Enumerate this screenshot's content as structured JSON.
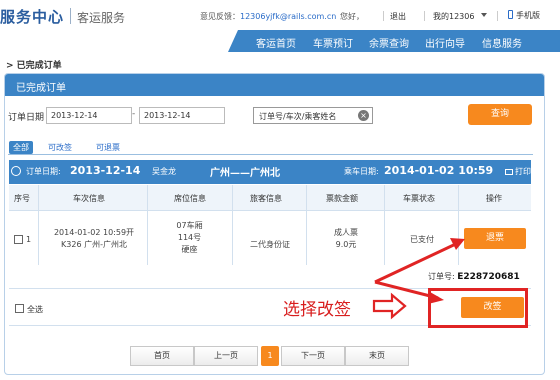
{
  "header": {
    "logo": "服务中心",
    "subtitle": "客运服务",
    "feedback_label": "意见反馈：",
    "feedback_email": "12306yjfk@rails.com.cn",
    "greeting": "您好，",
    "logout": "退出",
    "my_account": "我的12306",
    "mobile": "手机版"
  },
  "nav": {
    "items": [
      "客运首页",
      "车票预订",
      "余票查询",
      "出行向导",
      "信息服务"
    ]
  },
  "breadcrumb": "> 已完成订单",
  "panel": {
    "title": "已完成订单"
  },
  "search": {
    "date_label": "订单日期",
    "date_from": "2013-12-14",
    "date_to": "2013-12-14",
    "dash": "-",
    "keyword_placeholder": "订单号/车次/乘客姓名",
    "query_button": "查询"
  },
  "filters": {
    "all": "全部",
    "changeable": "可改签",
    "refundable": "可退票"
  },
  "order": {
    "order_date_label": "订单日期:",
    "order_date": "2013-12-14",
    "passenger": "吴金龙",
    "route": "广州——广州北",
    "ride_date_label": "乘车日期:",
    "ride_date": "2014-01-02 10:59",
    "print": "打印",
    "columns": [
      "序号",
      "车次信息",
      "席位信息",
      "旅客信息",
      "票款金额",
      "车票状态",
      "操作"
    ],
    "row": {
      "index": "1",
      "train_time": "2014-01-02 10:59开",
      "train_route": "K326 广州-广州北",
      "car": "07车厢",
      "seat_no": "114号",
      "seat_type": "硬座",
      "id_type": "二代身份证",
      "ticket_type": "成人票",
      "amount": "9.0元",
      "status": "已支付",
      "refund_button": "退票"
    },
    "order_no_label": "订单号:",
    "order_no": "E228720681",
    "select_all": "全选",
    "change_button": "改签"
  },
  "annotation": {
    "text": "选择改签",
    "color": "#d81e1e"
  },
  "pagination": {
    "first": "首页",
    "prev": "上一页",
    "current": "1",
    "next": "下一页",
    "last": "末页"
  },
  "colors": {
    "primary_blue": "#3b84c6",
    "accent_orange": "#f7891e"
  }
}
